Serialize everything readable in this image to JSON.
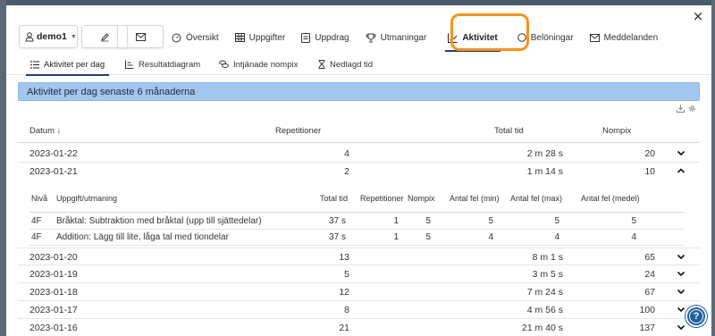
{
  "window": {
    "close_label": "×"
  },
  "user_select": {
    "value": "demo1"
  },
  "nav": {
    "tabs": [
      {
        "label": "Översikt",
        "icon": "gauge-icon"
      },
      {
        "label": "Uppgifter",
        "icon": "table-icon"
      },
      {
        "label": "Uppdrag",
        "icon": "document-icon"
      },
      {
        "label": "Utmaningar",
        "icon": "trophy-icon"
      },
      {
        "label": "Aktivitet",
        "icon": "chart-line-icon",
        "active": true
      },
      {
        "label": "Belöningar",
        "icon": "circle-icon"
      },
      {
        "label": "Meddelanden",
        "icon": "envelope-icon"
      }
    ]
  },
  "subtabs": [
    {
      "label": "Aktivitet per dag",
      "icon": "list-icon",
      "active": true
    },
    {
      "label": "Resultatdiagram",
      "icon": "chart-line-icon"
    },
    {
      "label": "Intjänade nompix",
      "icon": "coins-icon"
    },
    {
      "label": "Nedlagd tid",
      "icon": "hourglass-icon"
    }
  ],
  "panel": {
    "title": "Aktivitet per dag senaste 6 månaderna"
  },
  "table": {
    "headers": {
      "date": "Datum",
      "sort_arrow": "↓",
      "repetitions": "Repetitioner",
      "total_time": "Total tid",
      "nompix": "Nompix"
    },
    "rows": [
      {
        "date": "2023-01-22",
        "repetitions": "4",
        "total_time": "2 m 28 s",
        "nompix": "20",
        "expanded": false
      },
      {
        "date": "2023-01-21",
        "repetitions": "2",
        "total_time": "1 m 14 s",
        "nompix": "10",
        "expanded": true
      },
      {
        "date": "2023-01-20",
        "repetitions": "13",
        "total_time": "8 m 1 s",
        "nompix": "65",
        "expanded": false
      },
      {
        "date": "2023-01-19",
        "repetitions": "5",
        "total_time": "3 m 5 s",
        "nompix": "24",
        "expanded": false
      },
      {
        "date": "2023-01-18",
        "repetitions": "12",
        "total_time": "7 m 24 s",
        "nompix": "67",
        "expanded": false
      },
      {
        "date": "2023-01-17",
        "repetitions": "8",
        "total_time": "4 m 56 s",
        "nompix": "100",
        "expanded": false
      },
      {
        "date": "2023-01-16",
        "repetitions": "21",
        "total_time": "21 m 40 s",
        "nompix": "137",
        "expanded": false
      }
    ],
    "detail": {
      "headers": {
        "level": "Nivå",
        "task": "Uppgift/utmaning",
        "total_time": "Total tid",
        "repetitions": "Repetitioner",
        "nompix": "Nompix",
        "err_min": "Antal fel (min)",
        "err_max": "Antal fel (max)",
        "err_avg": "Antal fel (medel)"
      },
      "rows": [
        {
          "level": "4F",
          "task": "Bråktal: Subtraktion med bråktal (upp till sjättedelar)",
          "total_time": "37 s",
          "repetitions": "1",
          "nompix": "5",
          "err_min": "5",
          "err_max": "5",
          "err_avg": "5"
        },
        {
          "level": "4F",
          "task": "Addition: Lägg till lite, låga tal med tiondelar",
          "total_time": "37 s",
          "repetitions": "1",
          "nompix": "5",
          "err_min": "4",
          "err_max": "4",
          "err_avg": "4"
        }
      ]
    }
  },
  "help": {
    "label": "?"
  },
  "colors": {
    "accent": "#1f3d7a",
    "highlight": "#f5941d",
    "panel_header": "#a3c6ef",
    "help": "#1f5fa0"
  }
}
